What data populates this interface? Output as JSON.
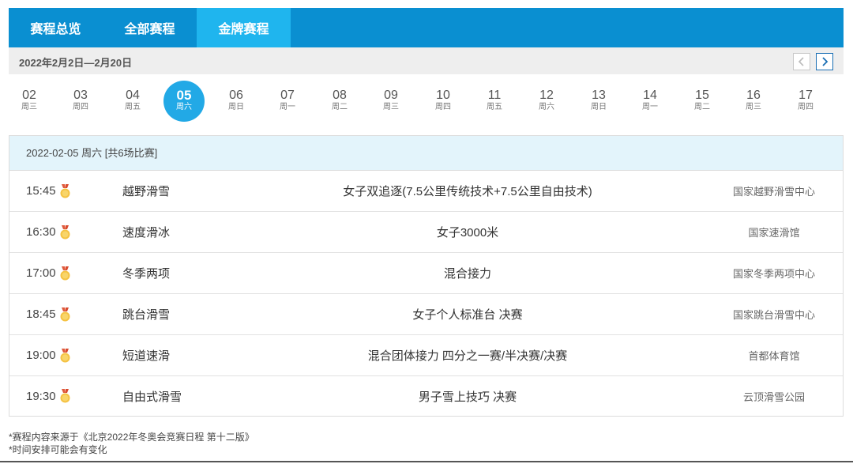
{
  "tabs": [
    {
      "label": "赛程总览",
      "active": false
    },
    {
      "label": "全部赛程",
      "active": false
    },
    {
      "label": "金牌赛程",
      "active": true
    }
  ],
  "date_range": "2022年2月2日—2月20日",
  "days": [
    {
      "num": "02",
      "wk": "周三"
    },
    {
      "num": "03",
      "wk": "周四"
    },
    {
      "num": "04",
      "wk": "周五"
    },
    {
      "num": "05",
      "wk": "周六",
      "active": true
    },
    {
      "num": "06",
      "wk": "周日"
    },
    {
      "num": "07",
      "wk": "周一"
    },
    {
      "num": "08",
      "wk": "周二"
    },
    {
      "num": "09",
      "wk": "周三"
    },
    {
      "num": "10",
      "wk": "周四"
    },
    {
      "num": "11",
      "wk": "周五"
    },
    {
      "num": "12",
      "wk": "周六"
    },
    {
      "num": "13",
      "wk": "周日"
    },
    {
      "num": "14",
      "wk": "周一"
    },
    {
      "num": "15",
      "wk": "周二"
    },
    {
      "num": "16",
      "wk": "周三"
    },
    {
      "num": "17",
      "wk": "周四"
    }
  ],
  "schedule": {
    "header": "2022-02-05 周六 [共6场比赛]",
    "rows": [
      {
        "time": "15:45",
        "sport": "越野滑雪",
        "event": "女子双追逐(7.5公里传统技术+7.5公里自由技术)",
        "venue": "国家越野滑雪中心"
      },
      {
        "time": "16:30",
        "sport": "速度滑冰",
        "event": "女子3000米",
        "venue": "国家速滑馆"
      },
      {
        "time": "17:00",
        "sport": "冬季两项",
        "event": "混合接力",
        "venue": "国家冬季两项中心"
      },
      {
        "time": "18:45",
        "sport": "跳台滑雪",
        "event": "女子个人标准台 决赛",
        "venue": "国家跳台滑雪中心"
      },
      {
        "time": "19:00",
        "sport": "短道速滑",
        "event": "混合团体接力 四分之一赛/半决赛/决赛",
        "venue": "首都体育馆"
      },
      {
        "time": "19:30",
        "sport": "自由式滑雪",
        "event": "男子雪上技巧 决赛",
        "venue": "云顶滑雪公园"
      }
    ]
  },
  "notes": [
    "*赛程内容来源于《北京2022年冬奥会竞赛日程 第十二版》",
    "*时间安排可能会有变化"
  ],
  "icons": {
    "medal": "gold-medal-icon",
    "prev": "chevron-left-icon",
    "next": "chevron-right-icon"
  },
  "colors": {
    "tabbar": "#0a8fd1",
    "tab_active": "#1fb5ee",
    "day_active": "#22a9e6",
    "schedule_header_bg": "#e3f4fb",
    "medal_gold": "#f5c242"
  }
}
